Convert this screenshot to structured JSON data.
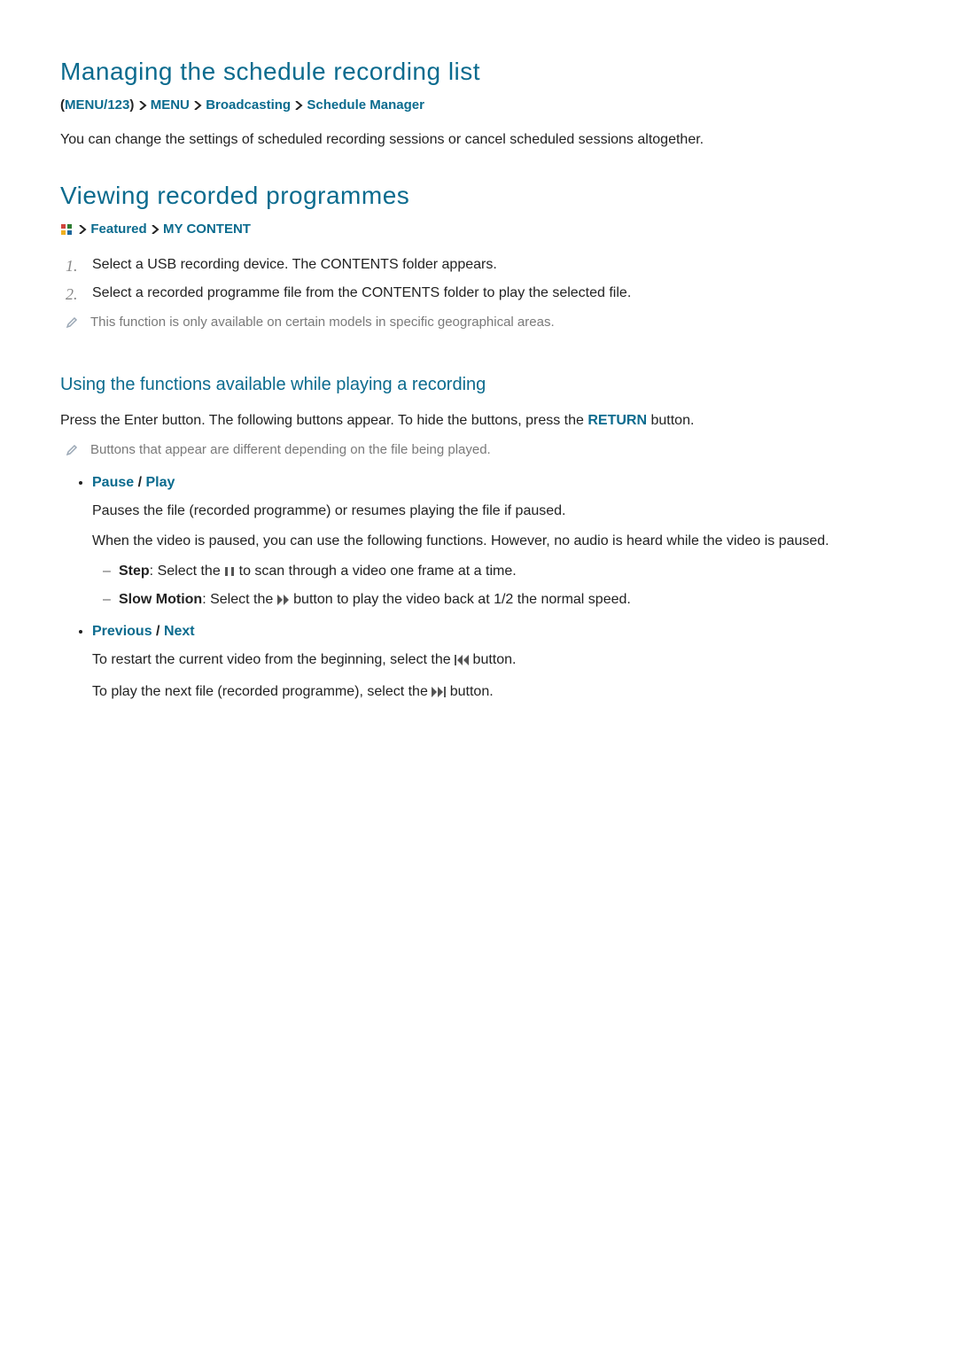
{
  "section1": {
    "title": "Managing the schedule recording list",
    "breadcrumb": {
      "paren_open": "(",
      "root": "MENU/123",
      "paren_close": ")",
      "a": "MENU",
      "b": "Broadcasting",
      "c": "Schedule Manager"
    },
    "body": "You can change the settings of scheduled recording sessions or cancel scheduled sessions altogether."
  },
  "section2": {
    "title": "Viewing recorded programmes",
    "breadcrumb": {
      "a": "Featured",
      "b": "MY CONTENT"
    },
    "steps": [
      "Select a USB recording device. The CONTENTS folder appears.",
      "Select a recorded programme file from the CONTENTS folder to play the selected file."
    ],
    "note": "This function is only available on certain models in specific geographical areas."
  },
  "section3": {
    "title": "Using the functions available while playing a recording",
    "intro_a": "Press the Enter button. The following buttons appear. To hide the buttons, press the ",
    "intro_return": "RETURN",
    "intro_b": " button.",
    "note": "Buttons that appear are different depending on the file being played.",
    "items": [
      {
        "head_a": "Pause",
        "head_sep": " / ",
        "head_b": "Play",
        "body1": "Pauses the file (recorded programme) or resumes playing the file if paused.",
        "body2": "When the video is paused, you can use the following functions. However, no audio is heard while the video is paused.",
        "sub": [
          {
            "label": "Step",
            "pre": ": Select the ",
            "post": " to scan through a video one frame at a time.",
            "icon": "pause-icon"
          },
          {
            "label": "Slow Motion",
            "pre": ": Select the ",
            "post": " button to play the video back at 1/2 the normal speed.",
            "icon": "fast-forward-icon"
          }
        ]
      },
      {
        "head_a": "Previous",
        "head_sep": " / ",
        "head_b": "Next",
        "body_pre_1": "To restart the current video from the beginning, select the ",
        "body_post_1": " button.",
        "body_pre_2": "To play the next file (recorded programme), select the ",
        "body_post_2": " button."
      }
    ]
  }
}
